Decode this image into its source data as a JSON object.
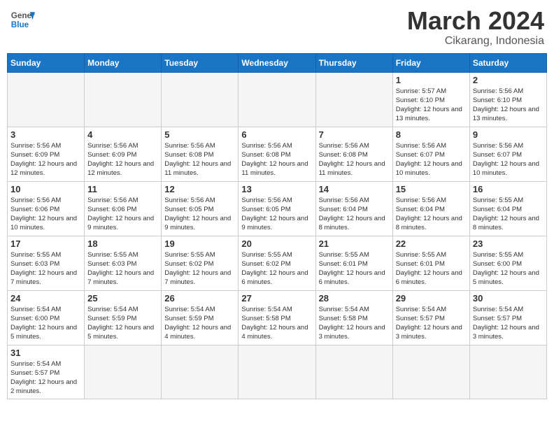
{
  "header": {
    "logo_general": "General",
    "logo_blue": "Blue",
    "month_title": "March 2024",
    "location": "Cikarang, Indonesia"
  },
  "weekdays": [
    "Sunday",
    "Monday",
    "Tuesday",
    "Wednesday",
    "Thursday",
    "Friday",
    "Saturday"
  ],
  "weeks": [
    [
      {
        "day": "",
        "info": ""
      },
      {
        "day": "",
        "info": ""
      },
      {
        "day": "",
        "info": ""
      },
      {
        "day": "",
        "info": ""
      },
      {
        "day": "",
        "info": ""
      },
      {
        "day": "1",
        "info": "Sunrise: 5:57 AM\nSunset: 6:10 PM\nDaylight: 12 hours\nand 13 minutes."
      },
      {
        "day": "2",
        "info": "Sunrise: 5:56 AM\nSunset: 6:10 PM\nDaylight: 12 hours\nand 13 minutes."
      }
    ],
    [
      {
        "day": "3",
        "info": "Sunrise: 5:56 AM\nSunset: 6:09 PM\nDaylight: 12 hours\nand 12 minutes."
      },
      {
        "day": "4",
        "info": "Sunrise: 5:56 AM\nSunset: 6:09 PM\nDaylight: 12 hours\nand 12 minutes."
      },
      {
        "day": "5",
        "info": "Sunrise: 5:56 AM\nSunset: 6:08 PM\nDaylight: 12 hours\nand 11 minutes."
      },
      {
        "day": "6",
        "info": "Sunrise: 5:56 AM\nSunset: 6:08 PM\nDaylight: 12 hours\nand 11 minutes."
      },
      {
        "day": "7",
        "info": "Sunrise: 5:56 AM\nSunset: 6:08 PM\nDaylight: 12 hours\nand 11 minutes."
      },
      {
        "day": "8",
        "info": "Sunrise: 5:56 AM\nSunset: 6:07 PM\nDaylight: 12 hours\nand 10 minutes."
      },
      {
        "day": "9",
        "info": "Sunrise: 5:56 AM\nSunset: 6:07 PM\nDaylight: 12 hours\nand 10 minutes."
      }
    ],
    [
      {
        "day": "10",
        "info": "Sunrise: 5:56 AM\nSunset: 6:06 PM\nDaylight: 12 hours\nand 10 minutes."
      },
      {
        "day": "11",
        "info": "Sunrise: 5:56 AM\nSunset: 6:06 PM\nDaylight: 12 hours\nand 9 minutes."
      },
      {
        "day": "12",
        "info": "Sunrise: 5:56 AM\nSunset: 6:05 PM\nDaylight: 12 hours\nand 9 minutes."
      },
      {
        "day": "13",
        "info": "Sunrise: 5:56 AM\nSunset: 6:05 PM\nDaylight: 12 hours\nand 9 minutes."
      },
      {
        "day": "14",
        "info": "Sunrise: 5:56 AM\nSunset: 6:04 PM\nDaylight: 12 hours\nand 8 minutes."
      },
      {
        "day": "15",
        "info": "Sunrise: 5:56 AM\nSunset: 6:04 PM\nDaylight: 12 hours\nand 8 minutes."
      },
      {
        "day": "16",
        "info": "Sunrise: 5:55 AM\nSunset: 6:04 PM\nDaylight: 12 hours\nand 8 minutes."
      }
    ],
    [
      {
        "day": "17",
        "info": "Sunrise: 5:55 AM\nSunset: 6:03 PM\nDaylight: 12 hours\nand 7 minutes."
      },
      {
        "day": "18",
        "info": "Sunrise: 5:55 AM\nSunset: 6:03 PM\nDaylight: 12 hours\nand 7 minutes."
      },
      {
        "day": "19",
        "info": "Sunrise: 5:55 AM\nSunset: 6:02 PM\nDaylight: 12 hours\nand 7 minutes."
      },
      {
        "day": "20",
        "info": "Sunrise: 5:55 AM\nSunset: 6:02 PM\nDaylight: 12 hours\nand 6 minutes."
      },
      {
        "day": "21",
        "info": "Sunrise: 5:55 AM\nSunset: 6:01 PM\nDaylight: 12 hours\nand 6 minutes."
      },
      {
        "day": "22",
        "info": "Sunrise: 5:55 AM\nSunset: 6:01 PM\nDaylight: 12 hours\nand 6 minutes."
      },
      {
        "day": "23",
        "info": "Sunrise: 5:55 AM\nSunset: 6:00 PM\nDaylight: 12 hours\nand 5 minutes."
      }
    ],
    [
      {
        "day": "24",
        "info": "Sunrise: 5:54 AM\nSunset: 6:00 PM\nDaylight: 12 hours\nand 5 minutes."
      },
      {
        "day": "25",
        "info": "Sunrise: 5:54 AM\nSunset: 5:59 PM\nDaylight: 12 hours\nand 5 minutes."
      },
      {
        "day": "26",
        "info": "Sunrise: 5:54 AM\nSunset: 5:59 PM\nDaylight: 12 hours\nand 4 minutes."
      },
      {
        "day": "27",
        "info": "Sunrise: 5:54 AM\nSunset: 5:58 PM\nDaylight: 12 hours\nand 4 minutes."
      },
      {
        "day": "28",
        "info": "Sunrise: 5:54 AM\nSunset: 5:58 PM\nDaylight: 12 hours\nand 3 minutes."
      },
      {
        "day": "29",
        "info": "Sunrise: 5:54 AM\nSunset: 5:57 PM\nDaylight: 12 hours\nand 3 minutes."
      },
      {
        "day": "30",
        "info": "Sunrise: 5:54 AM\nSunset: 5:57 PM\nDaylight: 12 hours\nand 3 minutes."
      }
    ],
    [
      {
        "day": "31",
        "info": "Sunrise: 5:54 AM\nSunset: 5:57 PM\nDaylight: 12 hours\nand 2 minutes."
      },
      {
        "day": "",
        "info": ""
      },
      {
        "day": "",
        "info": ""
      },
      {
        "day": "",
        "info": ""
      },
      {
        "day": "",
        "info": ""
      },
      {
        "day": "",
        "info": ""
      },
      {
        "day": "",
        "info": ""
      }
    ]
  ]
}
